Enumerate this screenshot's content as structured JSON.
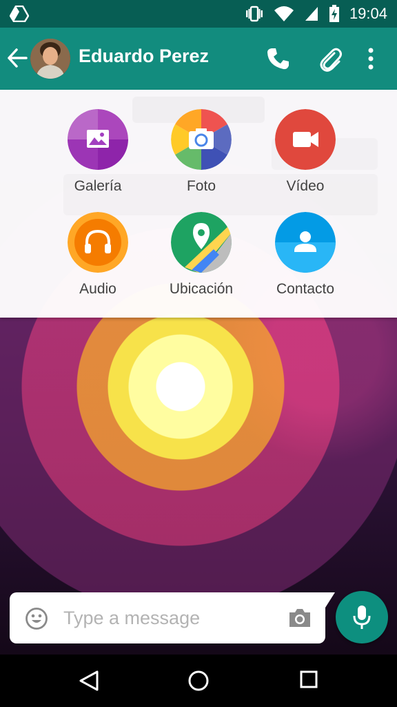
{
  "status_bar": {
    "time": "19:04",
    "icons": [
      "drive-icon",
      "vibrate-icon",
      "wifi-icon",
      "cell-signal-icon",
      "battery-charging-icon"
    ]
  },
  "header": {
    "contact_name": "Eduardo Perez",
    "icons": [
      "back-arrow-icon",
      "avatar",
      "phone-icon",
      "paperclip-icon",
      "more-vert-icon"
    ]
  },
  "attach_menu": {
    "items": [
      {
        "label": "Galería",
        "icon": "gallery-icon",
        "color": "#a23fc0"
      },
      {
        "label": "Foto",
        "icon": "camera-icon",
        "color": "#4a86e8"
      },
      {
        "label": "Vídeo",
        "icon": "video-icon",
        "color": "#e0483d"
      },
      {
        "label": "Audio",
        "icon": "headphones-icon",
        "color": "#f57c00"
      },
      {
        "label": "Ubicación",
        "icon": "map-pin-icon",
        "color": "#1ea362"
      },
      {
        "label": "Contacto",
        "icon": "contact-icon",
        "color": "#039be5"
      }
    ]
  },
  "composer": {
    "placeholder": "Type a message",
    "icons": [
      "emoji-icon",
      "camera-icon",
      "mic-icon"
    ]
  },
  "navigation": {
    "icons": [
      "nav-back-icon",
      "nav-home-icon",
      "nav-recents-icon"
    ]
  },
  "colors": {
    "primary": "#128c7e",
    "primary_dark": "#075e54",
    "mic_button": "#0d8f7f"
  }
}
